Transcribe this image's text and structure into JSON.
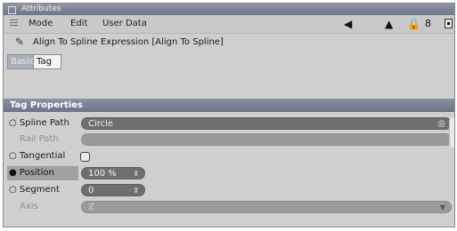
{
  "window": {
    "title": "Attributes"
  },
  "menu": {
    "items": [
      "Mode",
      "Edit",
      "User Data"
    ]
  },
  "object": {
    "title": "Align To Spline Expression [Align To Spline]"
  },
  "tabs": [
    {
      "label": "Basic"
    },
    {
      "label": "Tag"
    }
  ],
  "section": {
    "title": "Tag Properties"
  },
  "fields": {
    "spline_path": {
      "label": "Spline Path",
      "value": "Circle"
    },
    "rail_path": {
      "label": "Rail Path",
      "value": ""
    },
    "tangential": {
      "label": "Tangential",
      "checked": false
    },
    "position": {
      "label": "Position",
      "value": "100 %"
    },
    "segment": {
      "label": "Segment",
      "value": "0"
    },
    "axis": {
      "label": "Axis",
      "value": "Z"
    }
  }
}
